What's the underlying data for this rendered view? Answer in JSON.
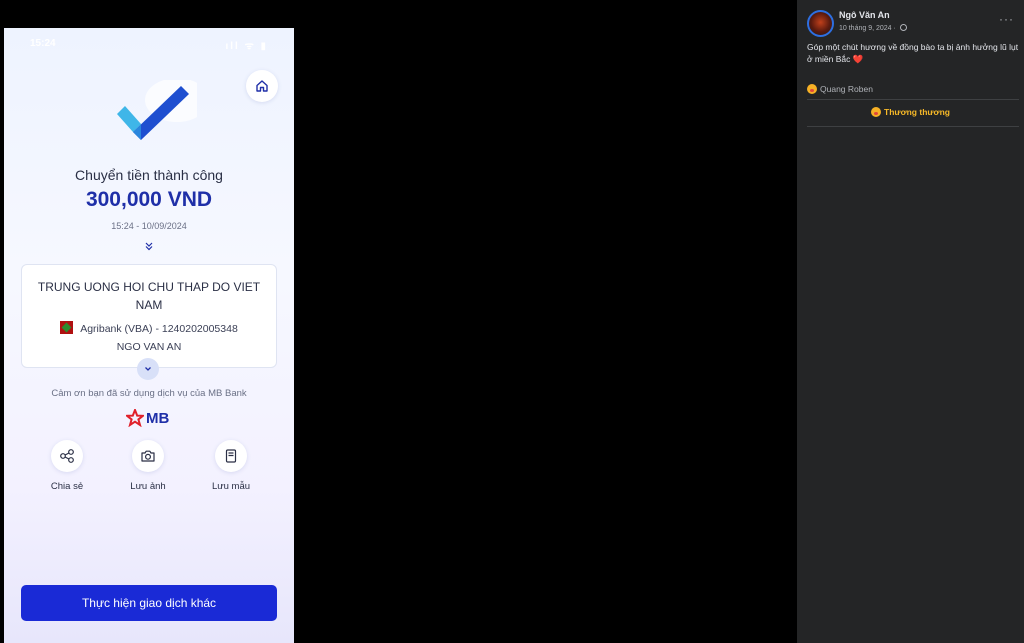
{
  "receipt": {
    "status_time": "15:24",
    "status_icons": "ıll ᯤ ▮",
    "success_title": "Chuyển tiền thành công",
    "amount": "300,000 VND",
    "datetime": "15:24 - 10/09/2024",
    "recipient_name": "TRUNG UONG HOI CHU THAP DO VIET NAM",
    "bank_account": "Agribank (VBA) - 1240202005348",
    "sender_name": "NGO VAN AN",
    "thanks_text": "Cảm ơn bạn đã sử dụng dịch vụ của MB Bank",
    "brand": "MB",
    "actions": [
      {
        "label": "Chia sẻ",
        "icon": "share-icon"
      },
      {
        "label": "Lưu ảnh",
        "icon": "camera-icon"
      },
      {
        "label": "Lưu mẫu",
        "icon": "template-icon"
      }
    ],
    "cta_label": "Thực hiện giao dịch khác",
    "colors": {
      "accent": "#1f2fa8",
      "button": "#1a2ad6",
      "brand_red": "#e0202a"
    }
  },
  "facebook_post": {
    "author": "Ngô Văn An",
    "date": "10 tháng 9, 2024 ·",
    "text": "Góp một chút hương về đồng bào ta bị ảnh hưởng lũ lụt ở miền Bắc ❤️",
    "reactor": "Quang Roben",
    "reaction_label": "Thương thương",
    "more_label": "···",
    "colors": {
      "background": "#242526",
      "reaction": "#f7b928"
    }
  }
}
